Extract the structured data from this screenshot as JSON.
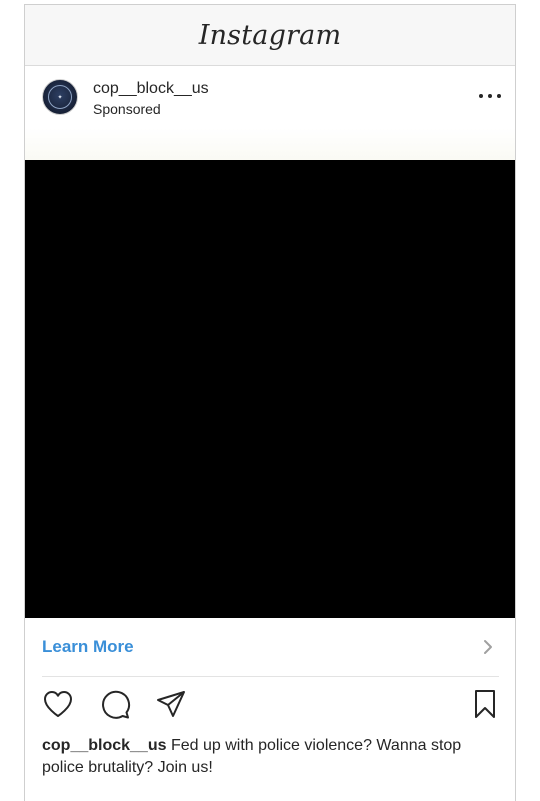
{
  "app": {
    "title": "Instagram"
  },
  "post": {
    "username": "cop__block__us",
    "label": "Sponsored",
    "cta": "Learn More",
    "caption_user": "cop__block__us",
    "caption_text": "Fed up with police violence? Wanna stop police brutality? Join us!"
  },
  "icons": {
    "more": "more-options-icon",
    "like": "heart-icon",
    "comment": "comment-icon",
    "share": "send-icon",
    "save": "bookmark-icon",
    "cta": "chevron-right-icon"
  },
  "colors": {
    "cta": "#3a8fd8",
    "media": "#000000"
  }
}
